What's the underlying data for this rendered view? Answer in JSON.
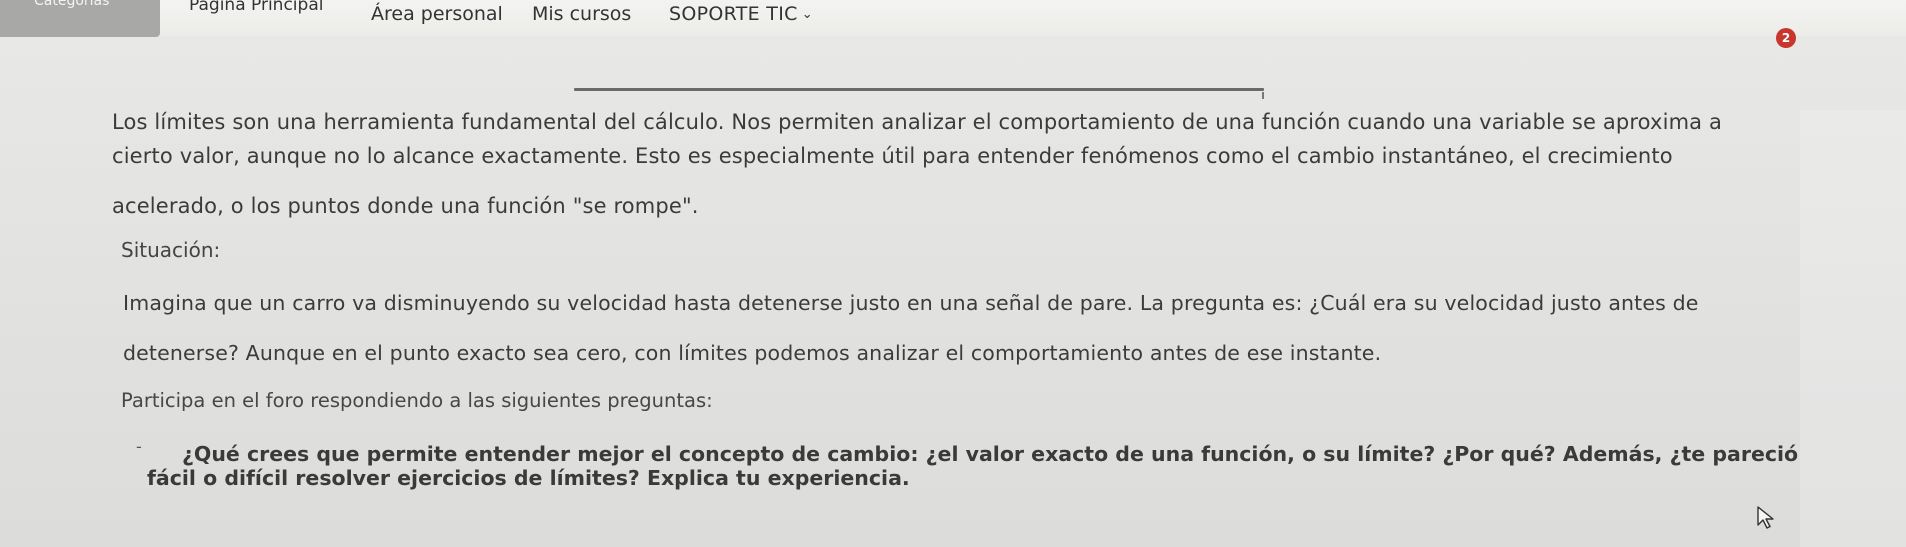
{
  "nav": {
    "categories": "Categorías",
    "items": [
      "Página Principal",
      "Área personal",
      "Mis cursos",
      "SOPORTE TIC"
    ],
    "notification_count": "2"
  },
  "content": {
    "intro_lines": [
      "Los límites son una herramienta fundamental del cálculo. Nos permiten analizar el comportamiento de una función cuando una variable se aproxima a",
      "cierto valor, aunque no lo alcance exactamente. Esto es especialmente útil para entender fenómenos como el cambio instantáneo, el crecimiento",
      "acelerado, o los puntos donde una función \"se rompe\"."
    ],
    "situation_heading": "Situación:",
    "situation_lines": [
      "Imagina que un carro va disminuyendo su velocidad hasta detenerse justo en una señal de pare. La pregunta es: ¿Cuál era su velocidad justo antes de",
      "detenerse? Aunque en el punto exacto sea cero, con límites podemos analizar el comportamiento antes de ese instante."
    ],
    "prompt": "Participa en el foro respondiendo a las siguientes preguntas:",
    "bullet_marker": "-",
    "question_lines": [
      "¿Qué crees que permite entender mejor el concepto de cambio: ¿el valor exacto de una función, o su límite? ¿Por qué? Además, ¿te pareció",
      "fácil o difícil resolver ejercicios de límites? Explica tu experiencia."
    ]
  },
  "colors": {
    "badge": "#c8372e",
    "nav_pill": "#a8a8a6",
    "background": "#e4e4e2"
  },
  "icons": [
    "chevron-down-icon",
    "mouse-cursor-icon"
  ]
}
